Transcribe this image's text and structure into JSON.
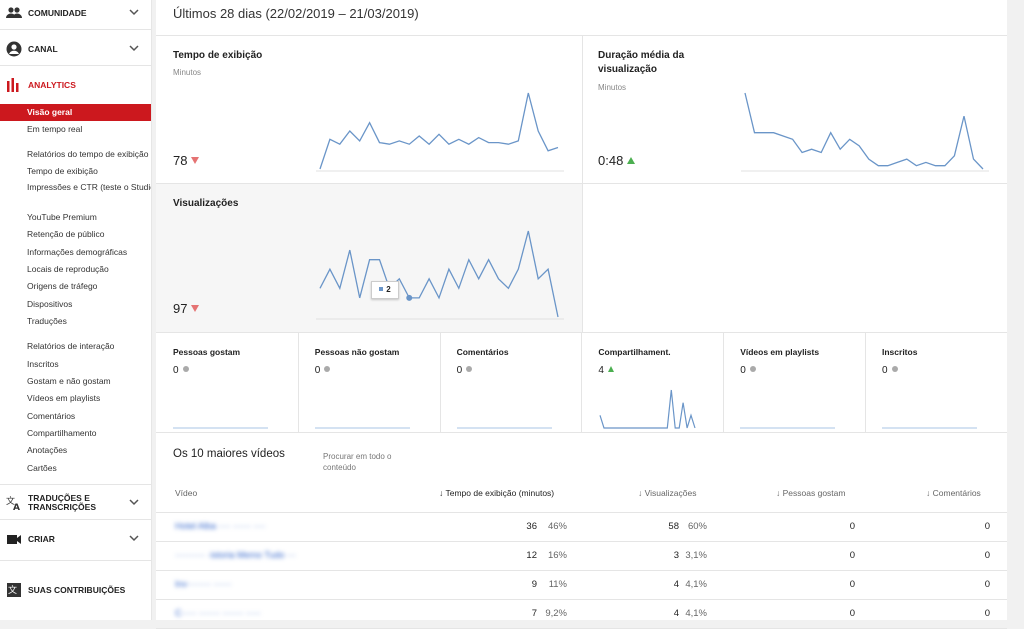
{
  "sidebar": {
    "community_label": "COMUNIDADE",
    "channel_label": "CANAL",
    "analytics_label": "ANALYTICS",
    "overview_label": "Visão geral",
    "realtime_label": "Em tempo real",
    "watch_reports_label": "Relatórios do tempo de exibição",
    "watch_items": [
      "Tempo de exibição",
      "Impressões e CTR (teste o Studio Beta)",
      "YouTube Premium",
      "Retenção de público",
      "Informações demográficas",
      "Locais de reprodução",
      "Origens de tráfego",
      "Dispositivos",
      "Traduções"
    ],
    "interaction_reports_label": "Relatórios de interação",
    "interaction_items": [
      "Inscritos",
      "Gostam e não gostam",
      "Vídeos em playlists",
      "Comentários",
      "Compartilhamento",
      "Anotações",
      "Cartões"
    ],
    "translations_label": "TRADUÇÕES E TRANSCRIÇÕES",
    "create_label": "CRIAR",
    "contributions_label": "SUAS CONTRIBUIÇÕES"
  },
  "header": {
    "date_range": "Últimos 28 dias (22/02/2019 – 21/03/2019)"
  },
  "cards": {
    "watch_time": {
      "title": "Tempo de exibição",
      "unit": "Minutos",
      "value": "78",
      "trend": "down"
    },
    "avg_duration": {
      "title": "Duração média da visualização",
      "unit": "Minutos",
      "value": "0:48",
      "trend": "up"
    },
    "views": {
      "title": "Visualizações",
      "value": "97",
      "trend": "down",
      "tooltip": "2"
    }
  },
  "sparklines": {
    "watch_time": [
      2,
      20,
      17,
      25,
      19,
      30,
      18,
      17,
      19,
      17,
      22,
      17,
      23,
      17,
      20,
      17,
      21,
      18,
      18,
      17,
      19,
      48,
      25,
      13,
      15
    ],
    "avg_duration": [
      42,
      30,
      30,
      30,
      29,
      28,
      24,
      25,
      24,
      30,
      25,
      28,
      26,
      22,
      20,
      20,
      21,
      22,
      20,
      21,
      20,
      20,
      23,
      35,
      22,
      19
    ],
    "views": [
      3,
      5,
      3,
      7,
      2,
      6,
      6,
      3,
      4,
      2,
      2,
      4,
      2,
      5,
      3,
      6,
      4,
      6,
      4,
      3,
      5,
      9,
      4,
      5,
      0
    ]
  },
  "metrics": [
    {
      "title": "Pessoas gostam",
      "value": "0",
      "indicator": "dot"
    },
    {
      "title": "Pessoas não gostam",
      "value": "0",
      "indicator": "dot"
    },
    {
      "title": "Comentários",
      "value": "0",
      "indicator": "dot"
    },
    {
      "title": "Compartilhament.",
      "value": "4",
      "indicator": "up"
    },
    {
      "title": "Vídeos em playlists",
      "value": "0",
      "indicator": "dot"
    },
    {
      "title": "Inscritos",
      "value": "0",
      "indicator": "dot"
    }
  ],
  "shares_series": [
    1,
    0,
    0,
    0,
    0,
    0,
    0,
    0,
    0,
    0,
    0,
    0,
    0,
    0,
    0,
    0,
    0,
    0,
    3,
    0,
    0,
    2,
    0,
    1,
    0
  ],
  "top_videos": {
    "title": "Os 10 maiores vídeos",
    "search_placeholder": "Procurar em todo o conteúdo",
    "columns": [
      "Vídeo",
      "Tempo de exibição (minutos)",
      "Visualizações",
      "Pessoas gostam",
      "Comentários"
    ],
    "rows": [
      {
        "title": "Hotel Alba ···· ······ ····",
        "watch": "36",
        "watch_pct": "46%",
        "views": "58",
        "views_pct": "60%",
        "likes": "0",
        "comments": "0"
      },
      {
        "title": "·········· ·istoria Memo Tudo ···",
        "watch": "12",
        "watch_pct": "16%",
        "views": "3",
        "views_pct": "3,1%",
        "likes": "0",
        "comments": "0"
      },
      {
        "title": "Inv········ ······",
        "watch": "9",
        "watch_pct": "11%",
        "views": "4",
        "views_pct": "4,1%",
        "likes": "0",
        "comments": "0"
      },
      {
        "title": "C····· ······· ······· ·····",
        "watch": "7",
        "watch_pct": "9,2%",
        "views": "4",
        "views_pct": "4,1%",
        "likes": "0",
        "comments": "0"
      }
    ]
  },
  "colors": {
    "accent_red": "#cc181e",
    "line_blue": "#6a95c8",
    "up_green": "#4caf50",
    "down_red": "#e57373"
  }
}
